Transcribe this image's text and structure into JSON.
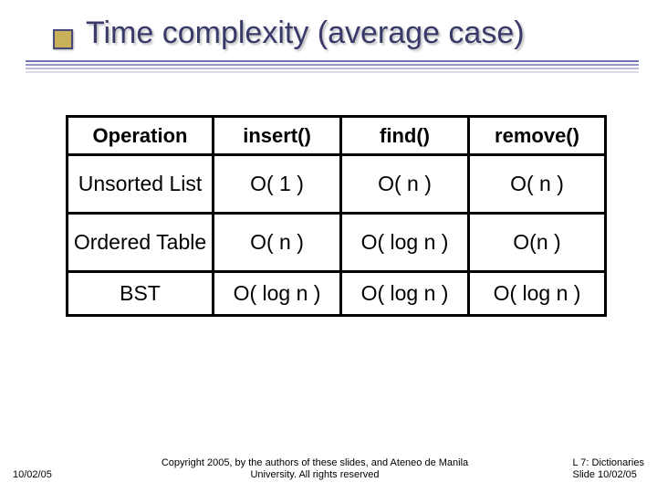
{
  "title": "Time complexity (average case)",
  "table": {
    "headers": [
      "Operation",
      "insert()",
      "find()",
      "remove()"
    ],
    "rows": [
      {
        "label": "Unsorted List",
        "cells": [
          "O( 1 )",
          "O( n )",
          "O( n )"
        ]
      },
      {
        "label": "Ordered Table",
        "cells": [
          "O( n )",
          "O( log n )",
          "O(n )"
        ]
      },
      {
        "label": "BST",
        "cells": [
          "O( log n )",
          "O( log n )",
          "O( log n )"
        ]
      }
    ]
  },
  "footer": {
    "date": "10/02/05",
    "center_line1": "Copyright 2005, by the authors of these slides, and Ateneo de Manila",
    "center_line2": "University. All rights reserved",
    "right_line1": "L 7: Dictionaries",
    "right_line2": "Slide 10/02/05"
  },
  "chart_data": {
    "type": "table",
    "title": "Time complexity (average case)",
    "columns": [
      "Operation",
      "insert()",
      "find()",
      "remove()"
    ],
    "rows": [
      [
        "Unsorted List",
        "O(1)",
        "O(n)",
        "O(n)"
      ],
      [
        "Ordered Table",
        "O(n)",
        "O(log n)",
        "O(n)"
      ],
      [
        "BST",
        "O(log n)",
        "O(log n)",
        "O(log n)"
      ]
    ]
  }
}
